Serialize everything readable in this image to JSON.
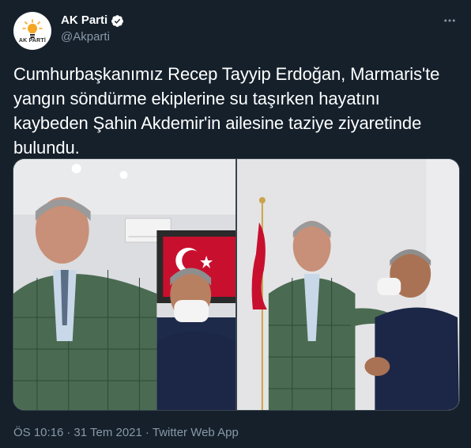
{
  "account": {
    "display_name": "AK Parti",
    "handle": "@Akparti",
    "avatar_label": "AK PARTİ",
    "verified": true
  },
  "tweet": {
    "text_lines": [
      "Cumhurbaşkanımız Recep Tayyip Erdoğan, Marmaris'te",
      "yangın söndürme ekiplerine su taşırken hayatını",
      "kaybeden Şahin Akdemir'in ailesine taziye ziyaretinde",
      "bulundu."
    ],
    "time": "ÖS 10:16",
    "separator": "·",
    "date": "31 Tem 2021",
    "source": "Twitter Web App"
  },
  "media": {
    "count": 2,
    "photos": [
      "photo-1",
      "photo-2"
    ]
  },
  "icons": {
    "verified": "verified-badge-icon",
    "more": "more-options-icon"
  },
  "colors": {
    "background": "#15202b",
    "secondary_text": "#8899a6",
    "verified_blue": "#ffffff",
    "border": "#38444d"
  }
}
